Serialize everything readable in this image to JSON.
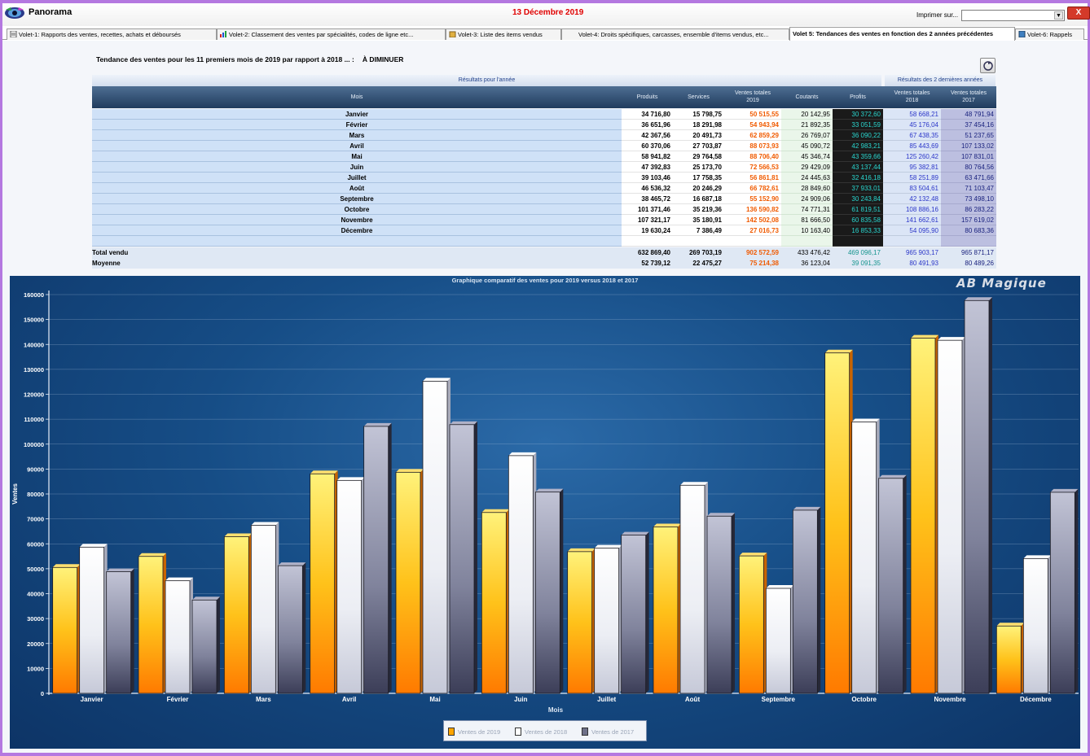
{
  "titlebar": {
    "app_title": "Panorama",
    "date": "13 Décembre 2019",
    "print_label": "Imprimer sur...",
    "print_value": "",
    "close_label": "X"
  },
  "tabs": [
    {
      "label": "Volet-1: Rapports des ventes, recettes, achats et déboursés",
      "icon": "report-icon"
    },
    {
      "label": "Volet-2: Classement des ventes par spécialités, codes de ligne etc...",
      "icon": "ranking-icon"
    },
    {
      "label": "Volet-3: Liste des items vendus",
      "icon": "items-icon"
    },
    {
      "label": "Volet-4: Droits spécifiques, carcasses, ensemble d'items vendus, etc...",
      "icon": ""
    },
    {
      "label": "Volet 5: Tendances des ventes en fonction des 2 années précédentes",
      "icon": ""
    },
    {
      "label": "Volet-6: Rappels",
      "icon": "book-icon"
    }
  ],
  "heading": {
    "text": "Tendance des ventes pour  les 11 premiers mois de 2019  par rapport à 2018 ... :",
    "status": "À DIMINUER"
  },
  "table": {
    "group_left": "Résultats pour l'année",
    "group_right": "Résultats des 2 dernières années",
    "columns": {
      "mois": "Mois",
      "produits": "Produits",
      "services": "Services",
      "vt19_a": "Ventes totales",
      "vt19_b": "2019",
      "coutants": "Coutants",
      "profits": "Profits",
      "vt18_a": "Ventes totales",
      "vt18_b": "2018",
      "vt17_a": "Ventes totales",
      "vt17_b": "2017"
    },
    "rows": [
      {
        "mois": "Janvier",
        "produits": "34 716,80",
        "services": "15 798,75",
        "vt2019": "50 515,55",
        "coutants": "20 142,95",
        "profits": "30 372,60",
        "vt2018": "58 668,21",
        "vt2017": "48 791,94"
      },
      {
        "mois": "Février",
        "produits": "36 651,96",
        "services": "18 291,98",
        "vt2019": "54 943,94",
        "coutants": "21 892,35",
        "profits": "33 051,59",
        "vt2018": "45 176,04",
        "vt2017": "37 454,16"
      },
      {
        "mois": "Mars",
        "produits": "42 367,56",
        "services": "20 491,73",
        "vt2019": "62 859,29",
        "coutants": "26 769,07",
        "profits": "36 090,22",
        "vt2018": "67 438,35",
        "vt2017": "51 237,65"
      },
      {
        "mois": "Avril",
        "produits": "60 370,06",
        "services": "27 703,87",
        "vt2019": "88 073,93",
        "coutants": "45 090,72",
        "profits": "42 983,21",
        "vt2018": "85 443,69",
        "vt2017": "107 133,02"
      },
      {
        "mois": "Mai",
        "produits": "58 941,82",
        "services": "29 764,58",
        "vt2019": "88 706,40",
        "coutants": "45 346,74",
        "profits": "43 359,66",
        "vt2018": "125 260,42",
        "vt2017": "107 831,01"
      },
      {
        "mois": "Juin",
        "produits": "47 392,83",
        "services": "25 173,70",
        "vt2019": "72 566,53",
        "coutants": "29 429,09",
        "profits": "43 137,44",
        "vt2018": "95 382,81",
        "vt2017": "80 764,56"
      },
      {
        "mois": "Juillet",
        "produits": "39 103,46",
        "services": "17 758,35",
        "vt2019": "56 861,81",
        "coutants": "24 445,63",
        "profits": "32 416,18",
        "vt2018": "58 251,89",
        "vt2017": "63 471,66"
      },
      {
        "mois": "Août",
        "produits": "46 536,32",
        "services": "20 246,29",
        "vt2019": "66 782,61",
        "coutants": "28 849,60",
        "profits": "37 933,01",
        "vt2018": "83 504,61",
        "vt2017": "71 103,47"
      },
      {
        "mois": "Septembre",
        "produits": "38 465,72",
        "services": "16 687,18",
        "vt2019": "55 152,90",
        "coutants": "24 909,06",
        "profits": "30 243,84",
        "vt2018": "42 132,48",
        "vt2017": "73 498,10"
      },
      {
        "mois": "Octobre",
        "produits": "101 371,46",
        "services": "35 219,36",
        "vt2019": "136 590,82",
        "coutants": "74 771,31",
        "profits": "61 819,51",
        "vt2018": "108 886,16",
        "vt2017": "86 283,22"
      },
      {
        "mois": "Novembre",
        "produits": "107 321,17",
        "services": "35 180,91",
        "vt2019": "142 502,08",
        "coutants": "81 666,50",
        "profits": "60 835,58",
        "vt2018": "141 662,61",
        "vt2017": "157 619,02"
      },
      {
        "mois": "Décembre",
        "produits": "19 630,24",
        "services": "7 386,49",
        "vt2019": "27 016,73",
        "coutants": "10 163,40",
        "profits": "16 853,33",
        "vt2018": "54 095,90",
        "vt2017": "80 683,36"
      }
    ],
    "total": {
      "mois": "Total vendu",
      "produits": "632 869,40",
      "services": "269 703,19",
      "vt2019": "902 572,59",
      "coutants": "433 476,42",
      "profits": "469 096,17",
      "vt2018": "965 903,17",
      "vt2017": "965 871,17"
    },
    "moyenne": {
      "mois": "Moyenne",
      "produits": "52 739,12",
      "services": "22 475,27",
      "vt2019": "75 214,38",
      "coutants": "36 123,04",
      "profits": "39 091,35",
      "vt2018": "80 491,93",
      "vt2017": "80 489,26"
    }
  },
  "brand": "AB  Magique",
  "chart_data": {
    "type": "bar",
    "title": "Graphique comparatif des ventes pour 2019 versus 2018 et 2017",
    "xlabel": "Mois",
    "ylabel": "Ventes",
    "ylim": [
      0,
      160000
    ],
    "yticks": [
      0,
      10000,
      20000,
      30000,
      40000,
      50000,
      60000,
      70000,
      80000,
      90000,
      100000,
      110000,
      120000,
      130000,
      140000,
      150000,
      160000
    ],
    "categories": [
      "Janvier",
      "Février",
      "Mars",
      "Avril",
      "Mai",
      "Juin",
      "Juillet",
      "Août",
      "Septembre",
      "Octobre",
      "Novembre",
      "Décembre"
    ],
    "series": [
      {
        "name": "Ventes de 2019",
        "color": "#ffc21a",
        "values": [
          50515.55,
          54943.94,
          62859.29,
          88073.93,
          88706.4,
          72566.53,
          56861.81,
          66782.61,
          55152.9,
          136590.82,
          142502.08,
          27016.73
        ]
      },
      {
        "name": "Ventes de 2018",
        "color": "#f2f2f6",
        "values": [
          58668.21,
          45176.04,
          67438.35,
          85443.69,
          125260.42,
          95382.81,
          58251.89,
          83504.61,
          42132.48,
          108886.16,
          141662.61,
          54095.9
        ]
      },
      {
        "name": "Ventes de 2017",
        "color": "#8a8ca4",
        "values": [
          48791.94,
          37454.16,
          51237.65,
          107133.02,
          107831.01,
          80764.56,
          63471.66,
          71103.47,
          73498.1,
          86283.22,
          157619.02,
          80683.36
        ]
      }
    ],
    "grid": true,
    "legend": "bottom"
  }
}
